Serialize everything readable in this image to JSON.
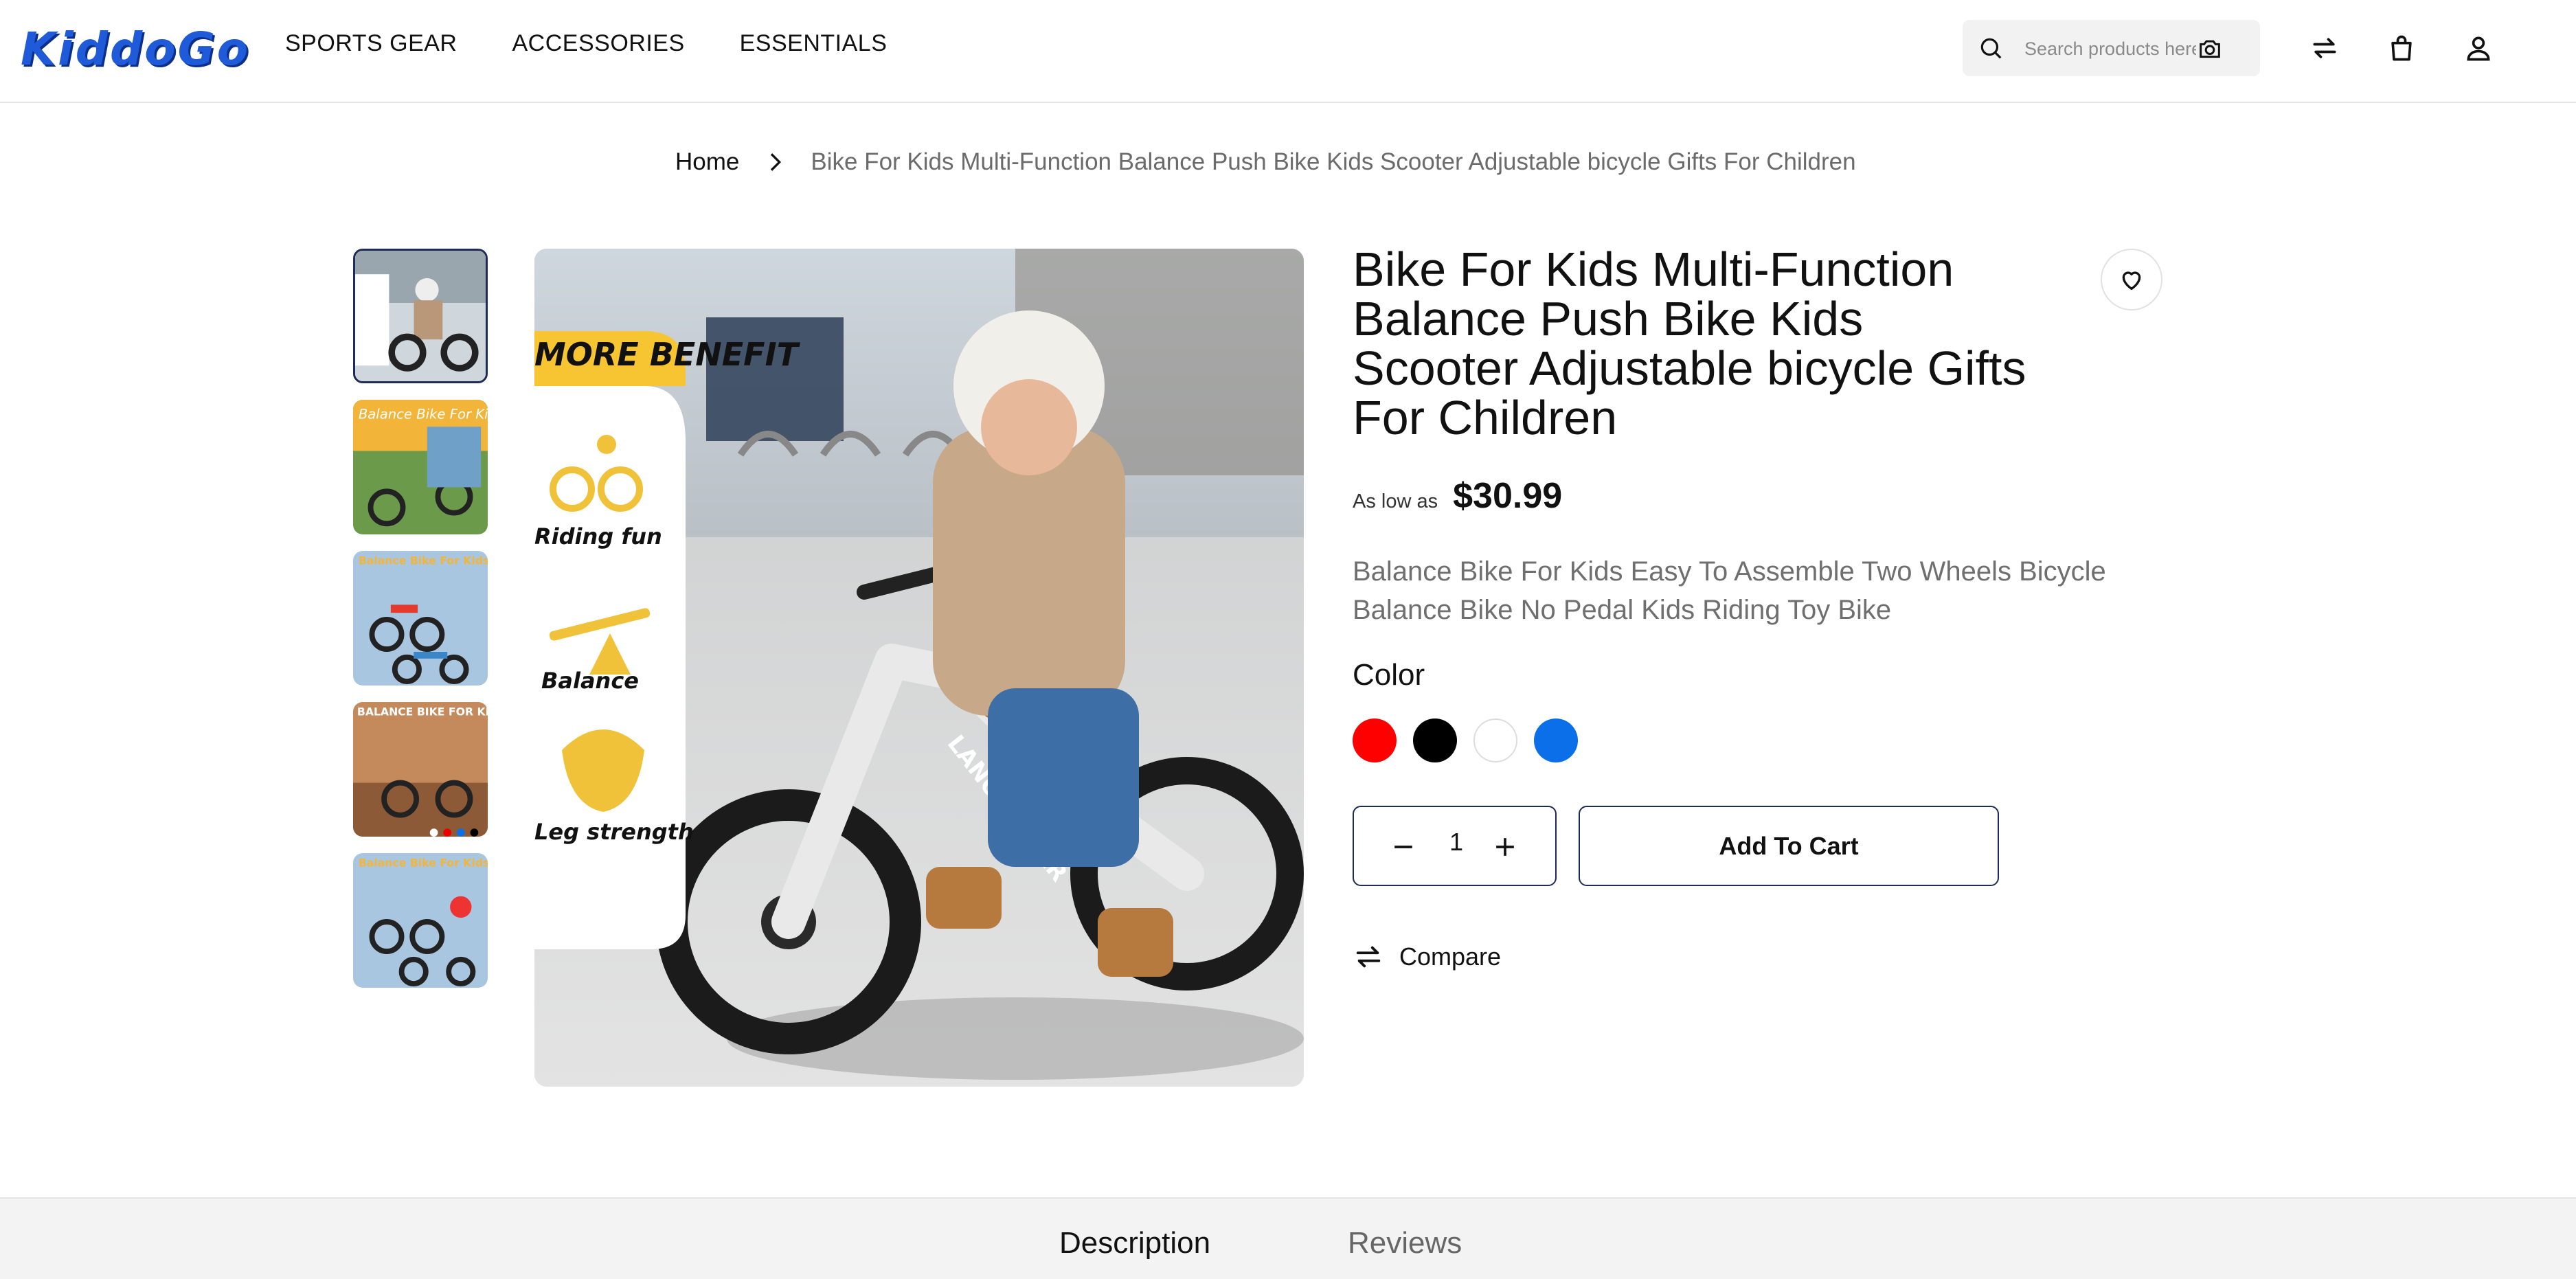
{
  "header": {
    "logo": "KiddoGo",
    "nav": [
      "SPORTS GEAR",
      "ACCESSORIES",
      "ESSENTIALS"
    ],
    "search_placeholder": "Search products here"
  },
  "breadcrumb": {
    "home": "Home",
    "current": "Bike For Kids Multi-Function Balance Push Bike Kids Scooter Adjustable bicycle Gifts For Children"
  },
  "main_image": {
    "banner_title": "MORE BENEFIT",
    "benefits": [
      "Riding fun",
      "Balance",
      "Leg strength"
    ],
    "frame_text": "LANOVAGEAR"
  },
  "thumbnails": [
    {
      "label": ""
    },
    {
      "label": "Balance Bike For Kids"
    },
    {
      "label": "Balance Bike For Kids"
    },
    {
      "label": "BALANCE BIKE FOR KIDS"
    },
    {
      "label": "Balance Bike For Kids"
    }
  ],
  "product": {
    "title": "Bike For Kids Multi-Function Balance Push Bike Kids Scooter Adjustable bicycle Gifts For Children",
    "price_label": "As low as",
    "price": "$30.99",
    "description": "Balance Bike For Kids Easy To Assemble Two Wheels Bicycle Balance Bike No Pedal Kids Riding Toy Bike",
    "color_label": "Color",
    "colors": [
      "#ff0000",
      "#000000",
      "#ffffff",
      "#0a6fe8"
    ],
    "quantity": "1",
    "add_to_cart": "Add To Cart",
    "compare": "Compare"
  },
  "tabs": [
    "Description",
    "Reviews"
  ],
  "theme": {
    "accent_navy": "#1d2b56",
    "logo_blue": "#1f5bd8",
    "banner_yellow": "#f7c531"
  }
}
